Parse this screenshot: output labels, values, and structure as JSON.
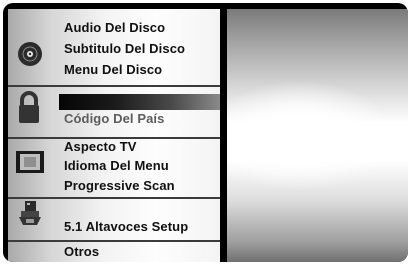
{
  "menu": {
    "group1": [
      "Audio Del Disco",
      "Subtitulo Del Disco",
      "Menu Del Disco"
    ],
    "group2": [
      "",
      "Código Del País"
    ],
    "group3": [
      "Aspecto TV",
      "Idioma Del Menu",
      "Progressive Scan"
    ],
    "group4": [
      "",
      "5.1 Altavoces Setup"
    ],
    "group5": [
      "Otros"
    ]
  },
  "icons": [
    "disc-icon",
    "lock-icon",
    "tv-icon",
    "speaker-icon"
  ],
  "colors": {
    "highlight": "#111111",
    "text": "#111111",
    "divider": "#3b3b3b"
  }
}
